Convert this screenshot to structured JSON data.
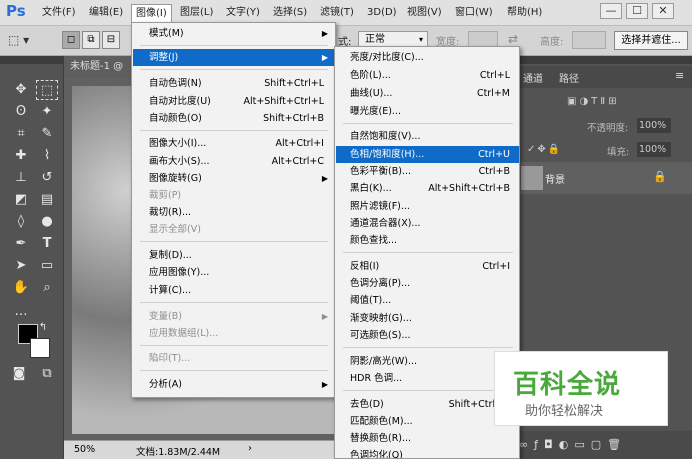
{
  "app": {
    "logo": "Ps"
  },
  "menubar": {
    "items": [
      "文件(F)",
      "编辑(E)",
      "图像(I)",
      "图层(L)",
      "文字(Y)",
      "选择(S)",
      "滤镜(T)",
      "3D(D)",
      "视图(V)",
      "窗口(W)",
      "帮助(H)"
    ],
    "window_buttons": [
      "—",
      "☐",
      "✕"
    ]
  },
  "options": {
    "style_label": "式:",
    "style_value": "正常",
    "width_label": "宽度:",
    "height_label": "高度:",
    "select_button": "选择并遮住..."
  },
  "document": {
    "tab_title": "未标题-1 @",
    "zoom": "50%",
    "doc_info": "文档:1.83M/2.44M"
  },
  "panels": {
    "tabs": [
      "通道",
      "路径"
    ],
    "opacity_label": "不透明度:",
    "opacity_value": "100%",
    "fill_label": "填充:",
    "fill_value": "100%",
    "layer_name": "背景"
  },
  "image_menu": {
    "items": [
      {
        "label": "模式(M)",
        "shortcut": "",
        "submenu": true,
        "disabled": false
      },
      {
        "label": "调整(J)",
        "shortcut": "",
        "submenu": true,
        "disabled": false,
        "highlighted": true
      },
      {
        "label": "自动色调(N)",
        "shortcut": "Shift+Ctrl+L"
      },
      {
        "label": "自动对比度(U)",
        "shortcut": "Alt+Shift+Ctrl+L"
      },
      {
        "label": "自动颜色(O)",
        "shortcut": "Shift+Ctrl+B"
      },
      {
        "label": "图像大小(I)...",
        "shortcut": "Alt+Ctrl+I"
      },
      {
        "label": "画布大小(S)...",
        "shortcut": "Alt+Ctrl+C"
      },
      {
        "label": "图像旋转(G)",
        "shortcut": "",
        "submenu": true
      },
      {
        "label": "裁剪(P)",
        "shortcut": "",
        "disabled": true
      },
      {
        "label": "裁切(R)...",
        "shortcut": ""
      },
      {
        "label": "显示全部(V)",
        "shortcut": "",
        "disabled": true
      },
      {
        "label": "复制(D)...",
        "shortcut": ""
      },
      {
        "label": "应用图像(Y)...",
        "shortcut": ""
      },
      {
        "label": "计算(C)...",
        "shortcut": ""
      },
      {
        "label": "变量(B)",
        "shortcut": "",
        "submenu": true,
        "disabled": true
      },
      {
        "label": "应用数据组(L)...",
        "shortcut": "",
        "disabled": true
      },
      {
        "label": "陷印(T)...",
        "shortcut": "",
        "disabled": true
      },
      {
        "label": "分析(A)",
        "shortcut": "",
        "submenu": true
      }
    ]
  },
  "adjust_menu": {
    "items": [
      {
        "label": "亮度/对比度(C)...",
        "shortcut": ""
      },
      {
        "label": "色阶(L)...",
        "shortcut": "Ctrl+L"
      },
      {
        "label": "曲线(U)...",
        "shortcut": "Ctrl+M"
      },
      {
        "label": "曝光度(E)...",
        "shortcut": ""
      },
      {
        "label": "自然饱和度(V)...",
        "shortcut": ""
      },
      {
        "label": "色相/饱和度(H)...",
        "shortcut": "Ctrl+U",
        "highlighted": true
      },
      {
        "label": "色彩平衡(B)...",
        "shortcut": "Ctrl+B"
      },
      {
        "label": "黑白(K)...",
        "shortcut": "Alt+Shift+Ctrl+B"
      },
      {
        "label": "照片滤镜(F)...",
        "shortcut": ""
      },
      {
        "label": "通道混合器(X)...",
        "shortcut": ""
      },
      {
        "label": "颜色查找...",
        "shortcut": ""
      },
      {
        "label": "反相(I)",
        "shortcut": "Ctrl+I"
      },
      {
        "label": "色调分离(P)...",
        "shortcut": ""
      },
      {
        "label": "阈值(T)...",
        "shortcut": ""
      },
      {
        "label": "渐变映射(G)...",
        "shortcut": ""
      },
      {
        "label": "可选颜色(S)...",
        "shortcut": ""
      },
      {
        "label": "阴影/高光(W)...",
        "shortcut": ""
      },
      {
        "label": "HDR 色调...",
        "shortcut": ""
      },
      {
        "label": "去色(D)",
        "shortcut": "Shift+Ctrl+U"
      },
      {
        "label": "匹配颜色(M)...",
        "shortcut": ""
      },
      {
        "label": "替换颜色(R)...",
        "shortcut": ""
      },
      {
        "label": "色调均化(Q)",
        "shortcut": ""
      }
    ]
  },
  "watermark": {
    "title": "百科全说",
    "subtitle": "助你轻松解决"
  },
  "colors": {
    "highlight": "#0f6bc7",
    "watermark_green": "#4aa83c",
    "ps_blue": "#2c6fd6"
  }
}
